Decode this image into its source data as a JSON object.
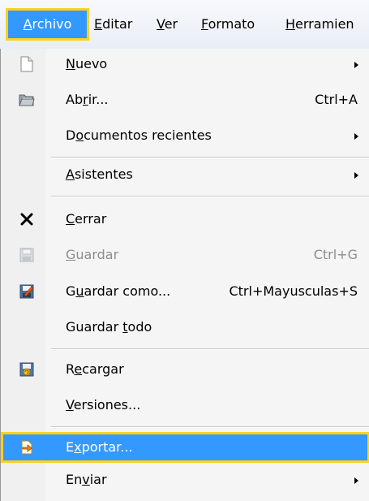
{
  "menubar": {
    "items": [
      {
        "label": "Archivo",
        "key": "A",
        "active": true
      },
      {
        "label": "Editar",
        "key": "E"
      },
      {
        "label": "Ver",
        "key": "V"
      },
      {
        "label": "Formato",
        "key": "F"
      },
      {
        "label": "Herramien",
        "key": "H"
      }
    ]
  },
  "menu": {
    "items": [
      {
        "id": "nuevo",
        "label": "Nuevo",
        "key": "N",
        "icon": "new-document-icon",
        "submenu": true
      },
      {
        "id": "abrir",
        "label": "Abrir...",
        "key": "r",
        "icon": "open-folder-icon",
        "shortcut": "Ctrl+A"
      },
      {
        "id": "recientes",
        "label": "Documentos recientes",
        "key": "o",
        "submenu": true
      },
      {
        "id": "asistentes",
        "label": "Asistentes",
        "key": "A",
        "submenu": true
      },
      {
        "id": "cerrar",
        "label": "Cerrar",
        "key": "C",
        "icon": "close-x-icon"
      },
      {
        "id": "guardar",
        "label": "Guardar",
        "key": "G",
        "icon": "save-disk-icon",
        "shortcut": "Ctrl+G",
        "disabled": true
      },
      {
        "id": "guardar-como",
        "label": "Guardar como...",
        "key": "u",
        "icon": "save-as-icon",
        "shortcut": "Ctrl+Mayusculas+S"
      },
      {
        "id": "guardar-todo",
        "label": "Guardar todo",
        "key": "t"
      },
      {
        "id": "recargar",
        "label": "Recargar",
        "key": "e",
        "icon": "reload-icon"
      },
      {
        "id": "versiones",
        "label": "Versiones...",
        "key": "V"
      },
      {
        "id": "exportar",
        "label": "Exportar...",
        "key": "x",
        "icon": "export-icon",
        "highlighted": true
      },
      {
        "id": "enviar",
        "label": "Enviar",
        "key": "v",
        "submenu": true
      }
    ]
  },
  "colors": {
    "highlight": "#3399ff",
    "focus_outline": "#ffd21f",
    "menu_background": "#f5f5f5",
    "disabled_text": "#8d8d8d"
  }
}
